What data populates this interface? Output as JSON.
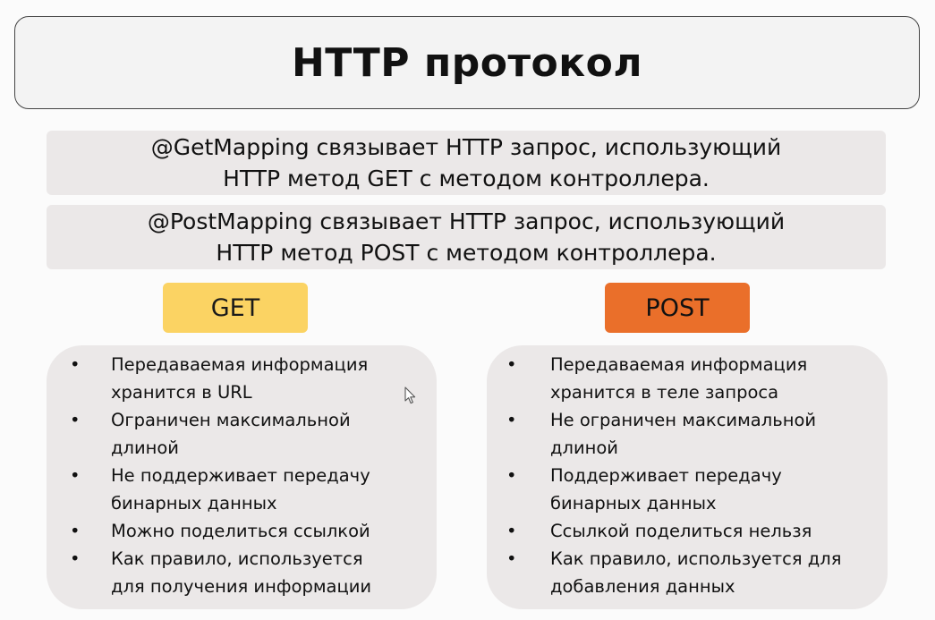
{
  "slide": {
    "title": "HTTP протокол",
    "get_mapping": {
      "lines": [
        "@GetMapping связывает HTTP запрос, использующий",
        "HTTP метод GET с методом контроллера."
      ]
    },
    "post_mapping": {
      "lines": [
        "@PostMapping связывает HTTP запрос, использующий",
        "HTTP метод POST с методом контроллера."
      ]
    },
    "get": {
      "label": "GET",
      "color": "#fbd363",
      "items": [
        [
          "Передаваемая информация",
          "хранится в URL"
        ],
        [
          "Ограничен максимальной",
          "длиной"
        ],
        [
          "Не поддерживает передачу",
          "бинарных данных"
        ],
        [
          "Можно поделиться ссылкой"
        ],
        [
          "Как правило, используется",
          "для получения информации"
        ]
      ]
    },
    "post": {
      "label": "POST",
      "color": "#ea6f2a",
      "items": [
        [
          "Передаваемая информация",
          "хранится в теле запроса"
        ],
        [
          "Не ограничен максимальной",
          "длиной"
        ],
        [
          "Поддерживает передачу",
          "бинарных данных"
        ],
        [
          "Ссылкой поделиться нельзя"
        ],
        [
          "Как правило, используется для",
          "добавления данных"
        ]
      ]
    },
    "bullet_symbol": "•"
  },
  "cursor": {
    "icon": "mouse-pointer-icon"
  }
}
